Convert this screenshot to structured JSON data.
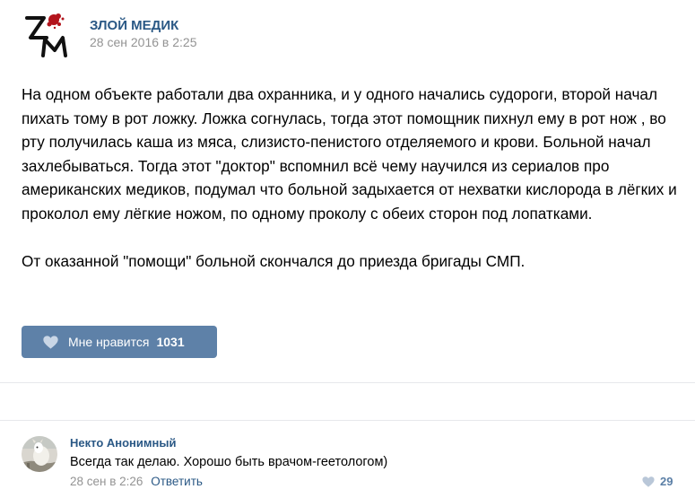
{
  "post": {
    "author": "ЗЛОЙ МЕДИК",
    "date": "28 сен 2016 в 2:25",
    "paragraphs": [
      "На одном объекте работали два охранника, и у одного начались судороги, второй начал пихать тому в рот ложку. Ложка согнулась, тогда этот помощник пихнул ему в рот нож , во рту получилась каша из мяса, слизисто-пенистого отделяемого и крови. Больной начал захлебываться. Тогда этот \"доктор\" вспомнил всё чему научился из сериалов про американских медиков, подумал что больной задыхается от нехватки кислорода в лёгких и проколол ему лёгкие ножом, по одному проколу с обеих сторон под лопатками.",
      "От оказанной \"помощи\" больной скончался до приезда бригады СМП."
    ],
    "avatar_logo_text": "ЗМ",
    "like_label": "Мне нравится",
    "like_count": "1031",
    "heart_icon": "heart-icon"
  },
  "comment": {
    "author": "Некто Анонимный",
    "text": "Всегда так делаю. Хорошо быть врачом-геетологом)",
    "date": "28 сен в 2:26",
    "reply_label": "Ответить",
    "like_count": "29",
    "heart_icon": "heart-icon"
  },
  "colors": {
    "link": "#2a5885",
    "muted": "#939393",
    "like_button": "#5e81a8",
    "divider": "#e7e8ec",
    "logo_red": "#b3141c"
  }
}
